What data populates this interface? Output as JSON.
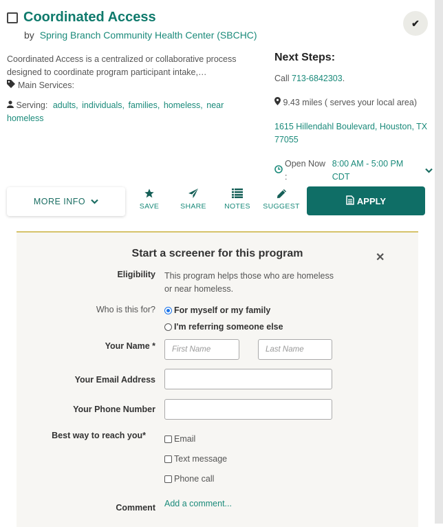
{
  "program": {
    "title": "Coordinated Access",
    "by_label": "by",
    "provider": "Spring Branch Community Health Center (SBCHC)",
    "description": "Coordinated Access is a centralized or collaborative process designed to coordinate program participant intake,…",
    "main_services_label": "Main Services:",
    "serving_label": "Serving:",
    "serving": [
      "adults,",
      "individuals,",
      "families,",
      "homeless,",
      "near homeless"
    ]
  },
  "next_steps": {
    "heading": "Next Steps:",
    "call_prefix": "Call",
    "phone": "713-6842303",
    "call_suffix": ".",
    "distance": "9.43 miles ( serves your local area)",
    "address": "1615 Hillendahl Boulevard, Houston, TX 77055",
    "open_status": "Open Now :",
    "hours": "8:00 AM - 5:00 PM CDT"
  },
  "actions": {
    "more_info": "MORE INFO",
    "save": "SAVE",
    "share": "SHARE",
    "notes": "NOTES",
    "suggest": "SUGGEST",
    "apply": "APPLY"
  },
  "screener": {
    "title": "Start a screener for this program",
    "eligibility_label": "Eligibility",
    "eligibility_text": "This program helps those who are homeless or near homeless.",
    "who_label": "Who is this for?",
    "who_options": [
      {
        "label": "For myself or my family",
        "selected": true
      },
      {
        "label": "I'm referring someone else",
        "selected": false
      }
    ],
    "name_label": "Your Name *",
    "first_name_placeholder": "First Name",
    "last_name_placeholder": "Last Name",
    "email_label": "Your Email Address",
    "email_value": "",
    "phone_label": "Your Phone Number",
    "phone_value": "",
    "reach_label": "Best way to reach you*",
    "reach_options": [
      {
        "label": "Email",
        "checked": false
      },
      {
        "label": "Text message",
        "checked": false
      },
      {
        "label": "Phone call",
        "checked": false
      }
    ],
    "comment_label": "Comment",
    "comment_link": "Add a comment..."
  },
  "colors": {
    "brand_teal": "#0f6e66",
    "link_teal": "#1a8a7a",
    "accent_gold": "#d6c36a",
    "panel_bg": "#f7f6f3"
  }
}
